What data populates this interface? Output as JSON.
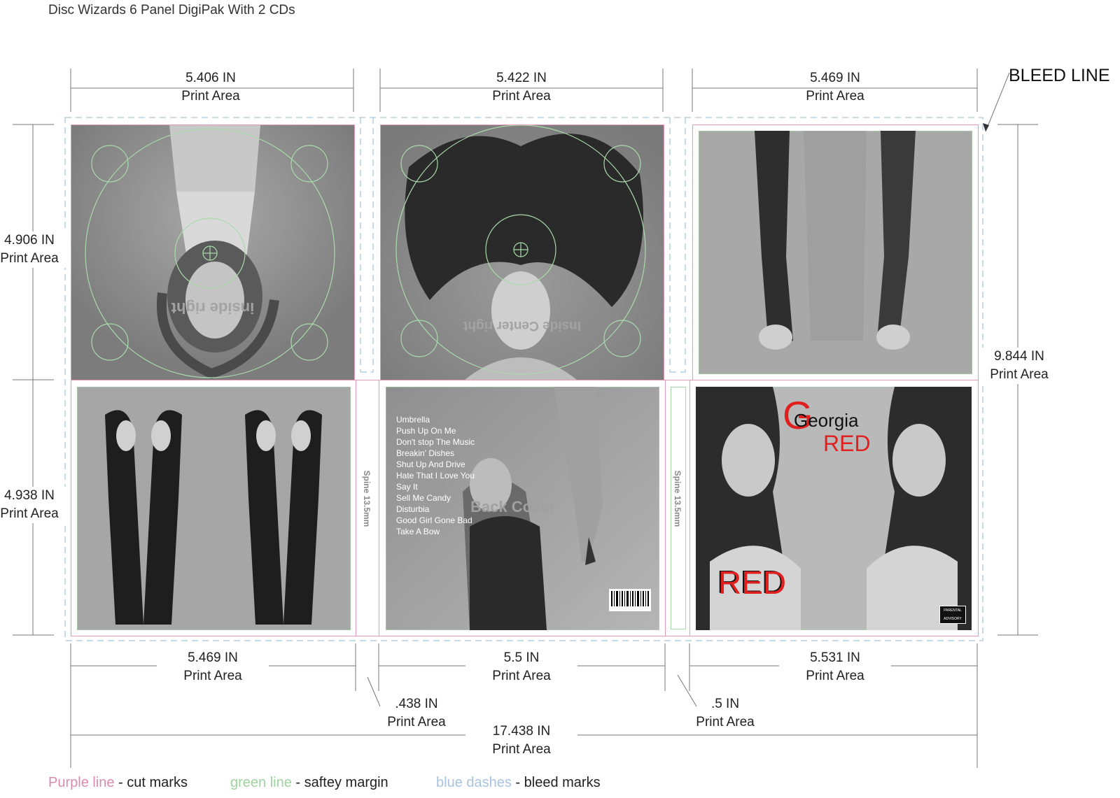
{
  "title": "Disc Wizards 6 Panel DigiPak With 2 CDs",
  "bleed_label": "BLEED LINE",
  "print_area": "Print Area",
  "top_dims": [
    "5.406 IN",
    "5.422 IN",
    "5.469 IN"
  ],
  "left_dims": [
    "4.906 IN",
    "4.938 IN"
  ],
  "right_dim": "9.844 IN",
  "bottom_dims": [
    "5.469 IN",
    "5.5 IN",
    "5.531 IN"
  ],
  "spine_dims": [
    ".438 IN",
    ".5 IN"
  ],
  "total_dim": "17.438 IN",
  "panels": {
    "inside_right": "inside right",
    "inside_center": "Inside Center right",
    "back_cover": "Back Cover",
    "spine": "Spine 13.5mm",
    "tracks": [
      "Umbrella",
      "Push Up On Me",
      "Don't stop The Music",
      "Breakin' Dishes",
      "Shut Up And Drive",
      "Hate That I Love You",
      "Say It",
      "Sell Me Candy",
      "Disturbia",
      "Good Girl Gone Bad",
      "Take A Bow"
    ],
    "front_title_letter": "G",
    "front_name": "Georgia",
    "front_red": "RED",
    "front_bottom_red": "RED",
    "advisory": "PARENTAL ADVISORY"
  },
  "legend": [
    {
      "swatch": "Purple line",
      "desc": " - cut marks",
      "color": "#d98bb0"
    },
    {
      "swatch": "green line",
      "desc": " - saftey margin",
      "color": "#9fd39f"
    },
    {
      "swatch": "blue dashes",
      "desc": " - bleed marks",
      "color": "#a8c4e0"
    }
  ],
  "colors": {
    "cut": "#e79ab5",
    "safety": "#a9dba9",
    "bleed": "#a9c6de",
    "accent_red": "#e01f1f"
  }
}
